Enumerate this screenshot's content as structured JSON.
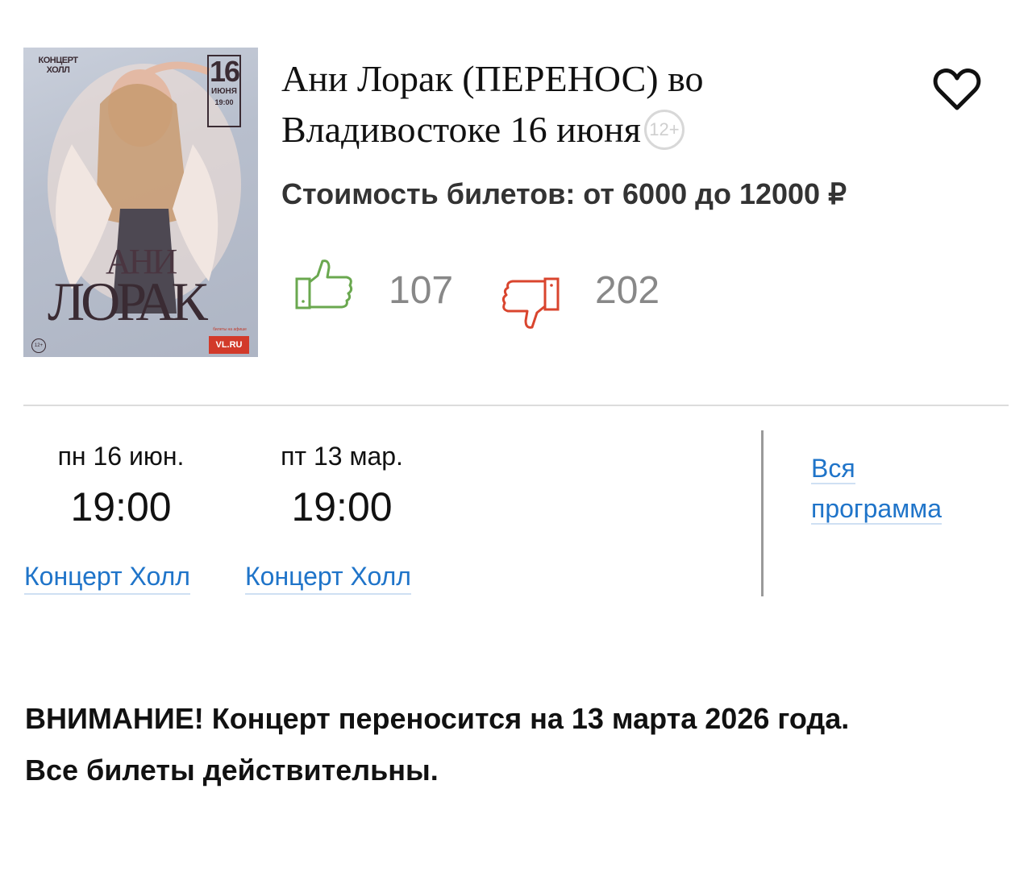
{
  "poster": {
    "top_left_label": "КОНЦЕРТ ХОЛЛ",
    "day": "16",
    "month": "ИЮНЯ",
    "time": "19:00",
    "name_line1": "АНИ",
    "name_line2": "ЛОРАК",
    "age": "12+",
    "small_text": "билеты на афише",
    "site": "VL.RU"
  },
  "event": {
    "title": "Ани Лорак (ПЕРЕНОС) во Владивостоке 16 июня",
    "age_badge": "12+",
    "price": "Стоимость билетов: от 6000 до 12000 ₽",
    "likes": "107",
    "dislikes": "202"
  },
  "sessions": [
    {
      "day": "пн 16 июн.",
      "time": "19:00",
      "venue": "Концерт Холл"
    },
    {
      "day": "пт 13 мар.",
      "time": "19:00",
      "venue": "Концерт Холл"
    }
  ],
  "program_link": {
    "line1": "Вся",
    "line2": "программа"
  },
  "notice": {
    "line1": "ВНИМАНИЕ! Концерт переносится на 13 марта 2026 года.",
    "line2": "Все билеты действительны."
  },
  "colors": {
    "link": "#1f74c9",
    "like": "#6aa84f",
    "dislike": "#d9452e",
    "muted": "#888888"
  }
}
